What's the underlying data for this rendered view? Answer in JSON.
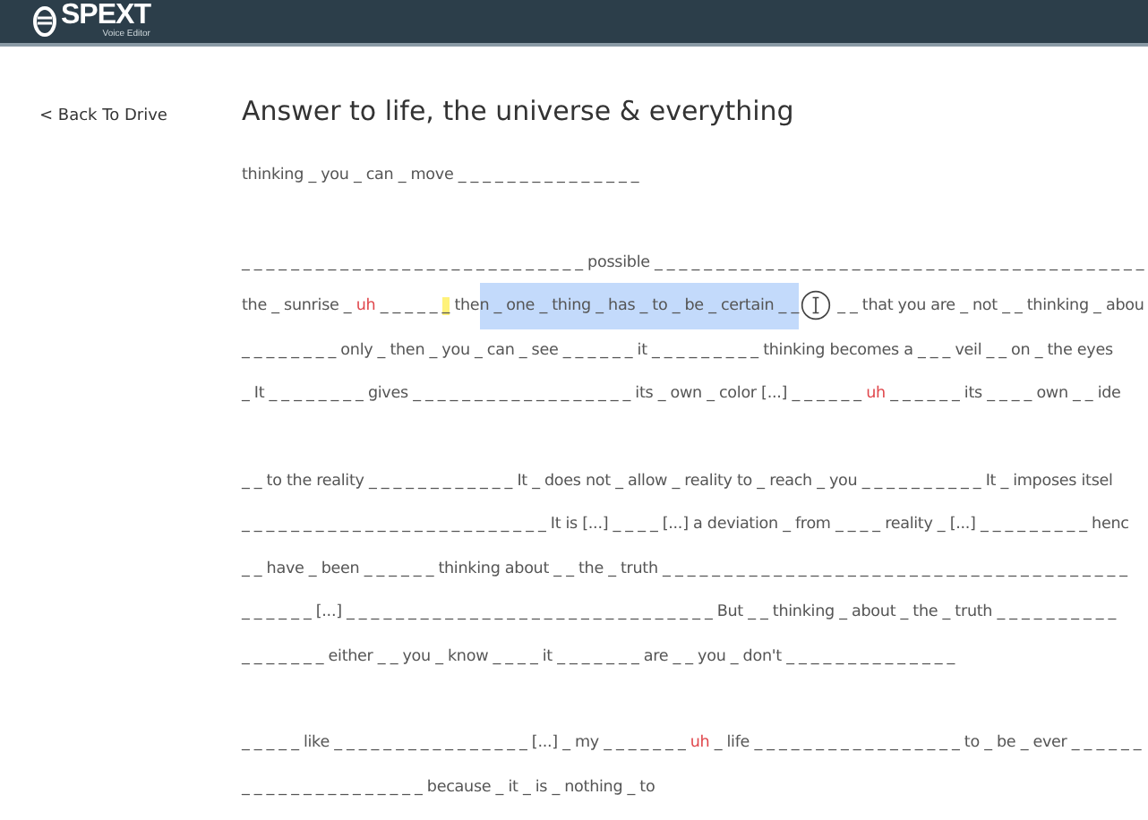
{
  "header": {
    "logo": "SPEXT",
    "subtitle": "Voice Editor"
  },
  "back_link": "< Back To Drive",
  "title": "Answer to life, the universe & everything",
  "paragraphs": [
    [
      [
        {
          "kind": "word",
          "text": "thinking _ you _ can _ move _ _ _ _ _ _ _ _ _ _ _ _ _ _ _"
        }
      ]
    ],
    [
      [
        {
          "kind": "word",
          "text": "_ _ _ _ _ _ _ _ _ _ _ _ _ _ _ _ _ _ _ _ _ _ _ _ _ _ _ _ possible _ _ _ _ _ _ _ _ _ _ _ _ _ _ _ _ _ _ _ _ _ _ _ _ _ _ _ _ _ _ _ _ _ _ _ _ _ _ _ _"
        }
      ],
      [
        {
          "kind": "word",
          "text": "the _ sunrise _ "
        },
        {
          "kind": "filler",
          "text": "uh"
        },
        {
          "kind": "word",
          "text": " _ _ _ _ _ "
        },
        {
          "kind": "highlight",
          "text": "_"
        },
        {
          "kind": "word",
          "text": " the"
        },
        {
          "kind": "selection",
          "text": "n _ one _ thing _ has _ to _ be _ certain _ _"
        },
        {
          "kind": "word",
          "text": " _ _ that you are _ not _ _ thinking _ abou"
        }
      ],
      [
        {
          "kind": "word",
          "text": "_ _ _ _ _ _ _ _ only _ then _ you _ can _ see _ _ _ _ _ _ it _ _ _ _ _ _ _ _ _ thinking becomes a _ _ _ veil _ _ on _ the eyes"
        }
      ],
      [
        {
          "kind": "word",
          "text": "_ It _ _ _ _ _ _ _ _ gives _ _ _ _ _ _ _ _ _ _ _ _ _ _ _ _ _ _ its _ own _ color [...] _ _ _ _ _ _ "
        },
        {
          "kind": "filler",
          "text": "uh"
        },
        {
          "kind": "word",
          "text": " _ _ _ _ _ _ its _ _ _ _ own _ _ ide"
        }
      ]
    ],
    [
      [
        {
          "kind": "word",
          "text": "_ _ to the reality _ _ _ _ _ _ _ _ _ _ _ _ It _ does not _ allow _ reality to _ reach _ you _ _ _ _ _ _ _ _ _ _ It _ imposes itsel"
        }
      ],
      [
        {
          "kind": "word",
          "text": "_ _ _ _ _ _ _ _ _ _ _ _ _ _ _ _ _ _ _ _ _ _ _ _ _ It is [...] _ _ _ _ [...] a deviation _ from _ _ _ _ reality _ [...] _ _ _ _ _ _ _ _ _ henc"
        }
      ],
      [
        {
          "kind": "word",
          "text": "_ _ have _ been _ _ _ _ _ _ thinking about _ _ the _ truth _ _ _ _ _ _ _ _ _ _ _ _ _ _ _ _ _ _ _ _ _ _ _ _ _ _ _ _ _ _ _ _ _ _ _ _ _ _"
        }
      ],
      [
        {
          "kind": "word",
          "text": "_ _ _ _ _ _ [...] _ _ _ _ _ _ _ _ _ _ _ _ _ _ _ _ _ _ _ _ _ _ _ _ _ _ _ _ _ _ But _ _ thinking _ about _ the _ truth _ _ _ _ _ _ _ _ _ _"
        }
      ],
      [
        {
          "kind": "word",
          "text": "_ _ _ _ _ _ _ either _ _ you _ know _ _ _ _ it _ _ _ _ _ _ _ are _ _ you _ don't _ _ _ _ _ _ _ _ _ _ _ _ _ _"
        }
      ]
    ],
    [
      [
        {
          "kind": "word",
          "text": "_ _ _ _ _ like _ _ _ _ _ _ _ _ _ _ _ _ _ _ _ _ [...] _ my _ _ _ _ _ _ _ "
        },
        {
          "kind": "filler",
          "text": "uh"
        },
        {
          "kind": "word",
          "text": " _ life _ _ _ _ _ _ _ _ _ _ _ _ _ _ _ _ _ to _ be _ ever _ _ _ _ _ _"
        }
      ],
      [
        {
          "kind": "word",
          "text": "_ _ _ _ _ _ _ _ _ _ _ _ _ _ _ because _ it _ is _ nothing _ to"
        }
      ]
    ]
  ]
}
